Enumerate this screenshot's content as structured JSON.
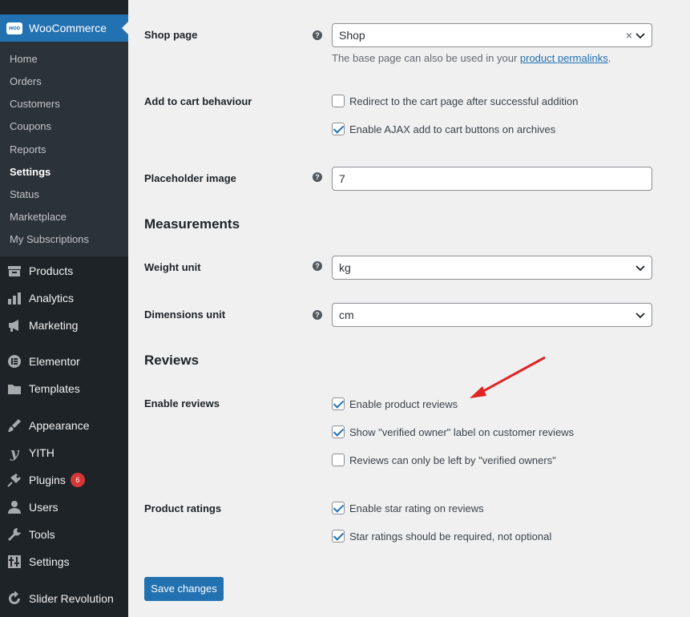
{
  "sidebar": {
    "brand": "WooCommerce",
    "submenu": [
      "Home",
      "Orders",
      "Customers",
      "Coupons",
      "Reports",
      "Settings",
      "Status",
      "Marketplace",
      "My Subscriptions"
    ],
    "active_submenu": "Settings",
    "items": [
      {
        "label": "Products",
        "icon": "archive-icon"
      },
      {
        "label": "Analytics",
        "icon": "bar-chart-icon"
      },
      {
        "label": "Marketing",
        "icon": "megaphone-icon"
      },
      {
        "label": "Elementor",
        "icon": "elementor-icon"
      },
      {
        "label": "Templates",
        "icon": "folder-icon"
      },
      {
        "label": "Appearance",
        "icon": "paintbrush-icon"
      },
      {
        "label": "YITH",
        "icon": "yith-icon"
      },
      {
        "label": "Plugins",
        "icon": "plug-icon",
        "badge": "6"
      },
      {
        "label": "Users",
        "icon": "user-icon"
      },
      {
        "label": "Tools",
        "icon": "wrench-icon"
      },
      {
        "label": "Settings",
        "icon": "sliders-icon"
      },
      {
        "label": "Slider Revolution",
        "icon": "refresh-icon"
      }
    ]
  },
  "main": {
    "shop_page": {
      "label": "Shop page",
      "value": "Shop",
      "desc_prefix": "The base page can also be used in your ",
      "desc_link": "product permalinks",
      "desc_suffix": "."
    },
    "add_to_cart": {
      "label": "Add to cart behaviour",
      "options": [
        {
          "label": "Redirect to the cart page after successful addition",
          "checked": false
        },
        {
          "label": "Enable AJAX add to cart buttons on archives",
          "checked": true
        }
      ]
    },
    "placeholder_image": {
      "label": "Placeholder image",
      "value": "7"
    },
    "measurements_title": "Measurements",
    "weight_unit": {
      "label": "Weight unit",
      "value": "kg"
    },
    "dimensions_unit": {
      "label": "Dimensions unit",
      "value": "cm"
    },
    "reviews_title": "Reviews",
    "enable_reviews": {
      "label": "Enable reviews",
      "options": [
        {
          "label": "Enable product reviews",
          "checked": true
        },
        {
          "label": "Show \"verified owner\" label on customer reviews",
          "checked": true
        },
        {
          "label": "Reviews can only be left by \"verified owners\"",
          "checked": false
        }
      ]
    },
    "product_ratings": {
      "label": "Product ratings",
      "options": [
        {
          "label": "Enable star rating on reviews",
          "checked": true
        },
        {
          "label": "Star ratings should be required, not optional",
          "checked": true
        }
      ]
    },
    "save_label": "Save changes",
    "help_glyph": "?",
    "clear_glyph": "×"
  },
  "colors": {
    "accent": "#2271b1",
    "sidebar": "#1d2327",
    "annotation": "#e02424"
  }
}
